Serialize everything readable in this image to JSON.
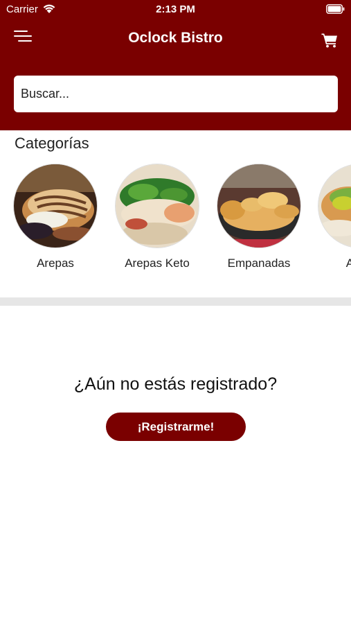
{
  "status_bar": {
    "carrier": "Carrier",
    "time": "2:13 PM"
  },
  "header": {
    "title": "Oclock Bistro",
    "menu_icon": "menu-icon",
    "cart_icon": "cart-icon"
  },
  "search": {
    "placeholder": "Buscar...",
    "value": ""
  },
  "categories": {
    "title": "Categorías",
    "items": [
      {
        "label": "Arepas",
        "image": "arepas-photo"
      },
      {
        "label": "Arepas Keto",
        "image": "arepas-keto-photo"
      },
      {
        "label": "Empanadas",
        "image": "empanadas-photo"
      },
      {
        "label": "Arma",
        "image": "arma-photo"
      }
    ]
  },
  "register": {
    "question": "¿Aún no estás registrado?",
    "button_label": "¡Registrarme!"
  },
  "colors": {
    "brand": "#7a0000",
    "divider": "#e6e6e6"
  }
}
